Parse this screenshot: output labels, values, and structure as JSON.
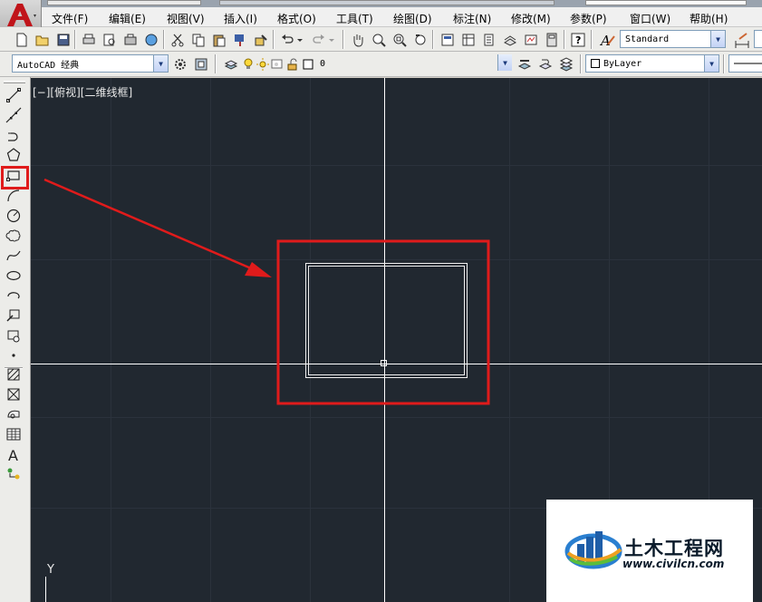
{
  "menu": {
    "items": [
      "文件(F)",
      "编辑(E)",
      "视图(V)",
      "插入(I)",
      "格式(O)",
      "工具(T)",
      "绘图(D)",
      "标注(N)",
      "修改(M)",
      "参数(P)",
      "窗口(W)",
      "帮助(H)"
    ]
  },
  "toolbar": {
    "text_style_value": "Standard",
    "workspace_value": "AutoCAD 经典",
    "layer_value": "0",
    "color_value": "ByLayer"
  },
  "viewport": {
    "label": "[−][俯视][二维线框]",
    "ucs_y_label": "Y"
  },
  "watermark": {
    "title": "土木工程网",
    "url": "www.civilcn.com"
  },
  "colors": {
    "canvas_bg": "#212830",
    "highlight_red": "#e01b1b",
    "crosshair": "#ffffff"
  },
  "icons": {
    "draw_tools": [
      "line-icon",
      "construction-line-icon",
      "polyline-icon",
      "polygon-icon",
      "rectangle-icon",
      "arc-icon",
      "circle-icon",
      "revision-cloud-icon",
      "spline-icon",
      "ellipse-icon",
      "ellipse-arc-icon",
      "insert-block-icon",
      "make-block-icon",
      "point-icon",
      "hatch-icon",
      "gradient-icon",
      "region-icon",
      "table-icon",
      "multiline-text-icon",
      "add-selected-icon"
    ]
  }
}
